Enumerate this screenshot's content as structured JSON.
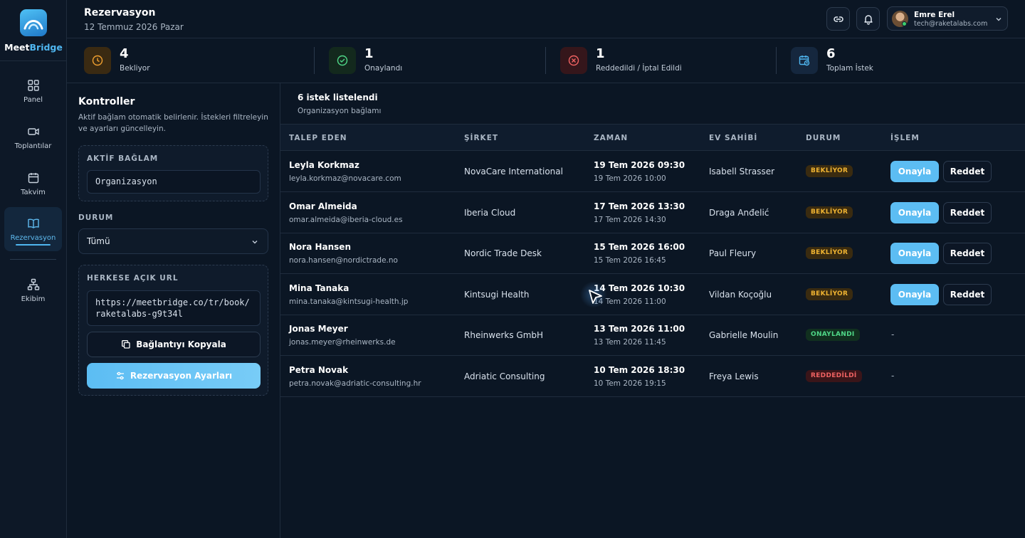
{
  "app": {
    "name_part1": "Meet",
    "name_part2": "Bridge",
    "brand_color": "#4fb6f0"
  },
  "nav": {
    "items": [
      {
        "label": "Panel",
        "icon": "grid-icon"
      },
      {
        "label": "Toplantılar",
        "icon": "video-icon"
      },
      {
        "label": "Takvim",
        "icon": "calendar-icon"
      },
      {
        "label": "Rezervasyon",
        "icon": "book-icon",
        "active": true
      },
      {
        "label": "Ekibim",
        "icon": "team-icon"
      }
    ]
  },
  "header": {
    "title": "Rezervasyon",
    "date": "12 Temmuz 2026 Pazar"
  },
  "user": {
    "name": "Emre Erel",
    "email": "tech@raketalabs.com"
  },
  "stats": [
    {
      "value": "4",
      "label": "Bekliyor",
      "color": "#f0a030"
    },
    {
      "value": "1",
      "label": "Onaylandı",
      "color": "#4fd888"
    },
    {
      "value": "1",
      "label": "Reddedildi / İptal Edildi",
      "color": "#f06262"
    },
    {
      "value": "6",
      "label": "Toplam İstek",
      "color": "#4fb6f0"
    }
  ],
  "controls": {
    "title": "Kontroller",
    "description": "Aktif bağlam otomatik belirlenir. İstekleri filtreleyin ve ayarları güncelleyin.",
    "context_label": "AKTİF BAĞLAM",
    "context_value": "Organizasyon",
    "status_label": "DURUM",
    "status_value": "Tümü",
    "url_label": "HERKESE AÇIK URL",
    "url_line1": "https://meetbridge.co/tr/book/",
    "url_line2": "raketalabs-g9t34l",
    "copy_button": "Bağlantıyı Kopyala",
    "settings_button": "Rezervasyon Ayarları"
  },
  "table": {
    "count_text": "6 istek listelendi",
    "subtitle": "Organizasyon bağlamı",
    "headers": [
      "TALEP EDEN",
      "ŞİRKET",
      "ZAMAN",
      "EV SAHİBİ",
      "DURUM",
      "İŞLEM"
    ],
    "approve_label": "Onayla",
    "reject_label": "Reddet",
    "rows": [
      {
        "name": "Leyla Korkmaz",
        "email": "leyla.korkmaz@novacare.com",
        "company": "NovaCare International",
        "time_start": "19 Tem 2026 09:30",
        "time_end": "19 Tem 2026 10:00",
        "host": "Isabell Strasser",
        "status": "BEKLİYOR",
        "status_type": "pending",
        "action": ""
      },
      {
        "name": "Omar Almeida",
        "email": "omar.almeida@iberia-cloud.es",
        "company": "Iberia Cloud",
        "time_start": "17 Tem 2026 13:30",
        "time_end": "17 Tem 2026 14:30",
        "host": "Draga Anđelić",
        "status": "BEKLİYOR",
        "status_type": "pending",
        "action": ""
      },
      {
        "name": "Nora Hansen",
        "email": "nora.hansen@nordictrade.no",
        "company": "Nordic Trade Desk",
        "time_start": "15 Tem 2026 16:00",
        "time_end": "15 Tem 2026 16:45",
        "host": "Paul Fleury",
        "status": "BEKLİYOR",
        "status_type": "pending",
        "action": ""
      },
      {
        "name": "Mina Tanaka",
        "email": "mina.tanaka@kintsugi-health.jp",
        "company": "Kintsugi Health",
        "time_start": "14 Tem 2026 10:30",
        "time_end": "14 Tem 2026 11:00",
        "host": "Vildan Koçoğlu",
        "status": "BEKLİYOR",
        "status_type": "pending",
        "action": ""
      },
      {
        "name": "Jonas Meyer",
        "email": "jonas.meyer@rheinwerks.de",
        "company": "Rheinwerks GmbH",
        "time_start": "13 Tem 2026 11:00",
        "time_end": "13 Tem 2026 11:45",
        "host": "Gabrielle Moulin",
        "status": "ONAYLANDI",
        "status_type": "approved",
        "action": "-"
      },
      {
        "name": "Petra Novak",
        "email": "petra.novak@adriatic-consulting.hr",
        "company": "Adriatic Consulting",
        "time_start": "10 Tem 2026 18:30",
        "time_end": "10 Tem 2026 19:15",
        "host": "Freya Lewis",
        "status": "REDDEDİLDİ",
        "status_type": "rejected",
        "action": "-"
      }
    ]
  }
}
